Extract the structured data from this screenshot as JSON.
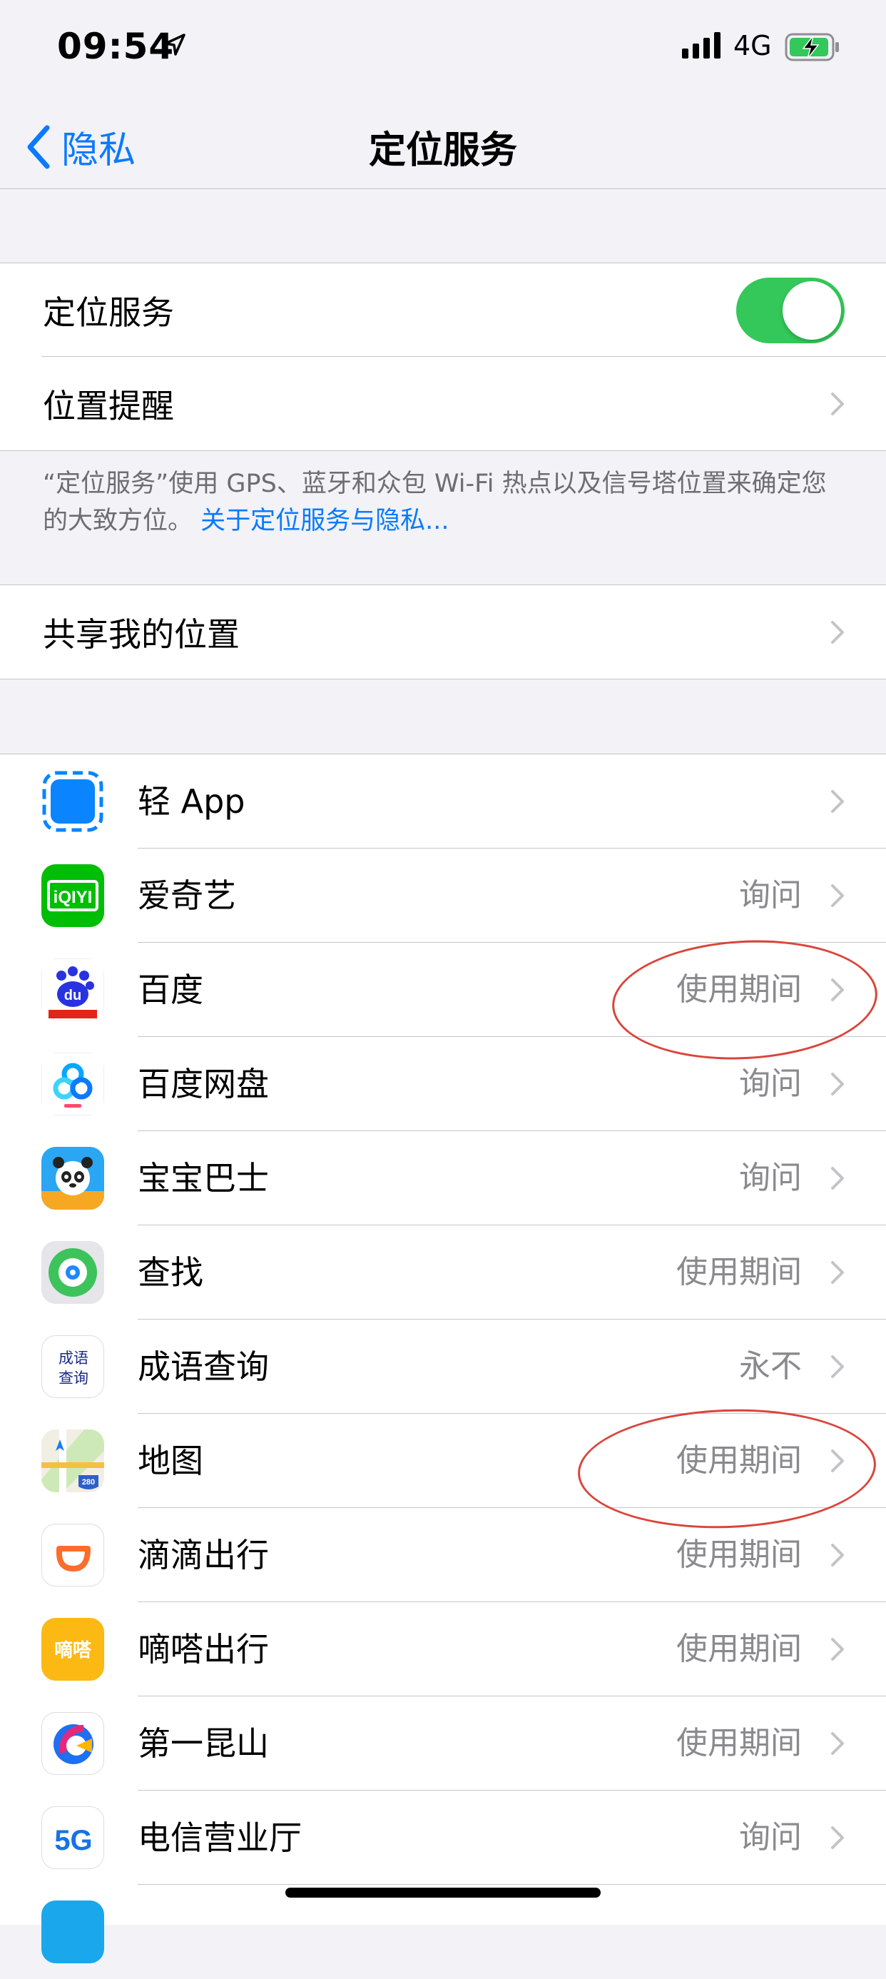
{
  "status_bar": {
    "time": "09:54",
    "network": "4G"
  },
  "nav": {
    "back_label": "隐私",
    "title": "定位服务"
  },
  "settings": {
    "location_services_label": "定位服务",
    "location_services_enabled": true,
    "location_alerts_label": "位置提醒",
    "footnote_text": "“定位服务”使用 GPS、蓝牙和众包 Wi-Fi 热点以及信号塔位置来确定您的大致方位。",
    "footnote_link": "关于定位服务与隐私...",
    "share_location_label": "共享我的位置"
  },
  "apps": [
    {
      "name": "轻 App",
      "value": "",
      "icon": "light-app-icon"
    },
    {
      "name": "爱奇艺",
      "value": "询问",
      "icon": "iqiyi-icon",
      "icon_text": "iQIYI"
    },
    {
      "name": "百度",
      "value": "使用期间",
      "icon": "baidu-icon",
      "icon_text": "du"
    },
    {
      "name": "百度网盘",
      "value": "询问",
      "icon": "baidu-netdisk-icon"
    },
    {
      "name": "宝宝巴士",
      "value": "询问",
      "icon": "babybus-icon"
    },
    {
      "name": "查找",
      "value": "使用期间",
      "icon": "find-my-icon"
    },
    {
      "name": "成语查询",
      "value": "永不",
      "icon": "idiom-lookup-icon",
      "icon_text": "成语\n查询"
    },
    {
      "name": "地图",
      "value": "使用期间",
      "icon": "maps-icon",
      "icon_text": "280"
    },
    {
      "name": "滴滴出行",
      "value": "使用期间",
      "icon": "didi-icon"
    },
    {
      "name": "嘀嗒出行",
      "value": "使用期间",
      "icon": "dida-icon",
      "icon_text": "嘀嗒"
    },
    {
      "name": "第一昆山",
      "value": "使用期间",
      "icon": "diyi-kunshan-icon"
    },
    {
      "name": "电信营业厅",
      "value": "询问",
      "icon": "telecom-icon",
      "icon_text": "5G"
    }
  ],
  "colors": {
    "accent": "#0a7aff",
    "toggle_on": "#34c759",
    "annotation": "#d9453c"
  }
}
